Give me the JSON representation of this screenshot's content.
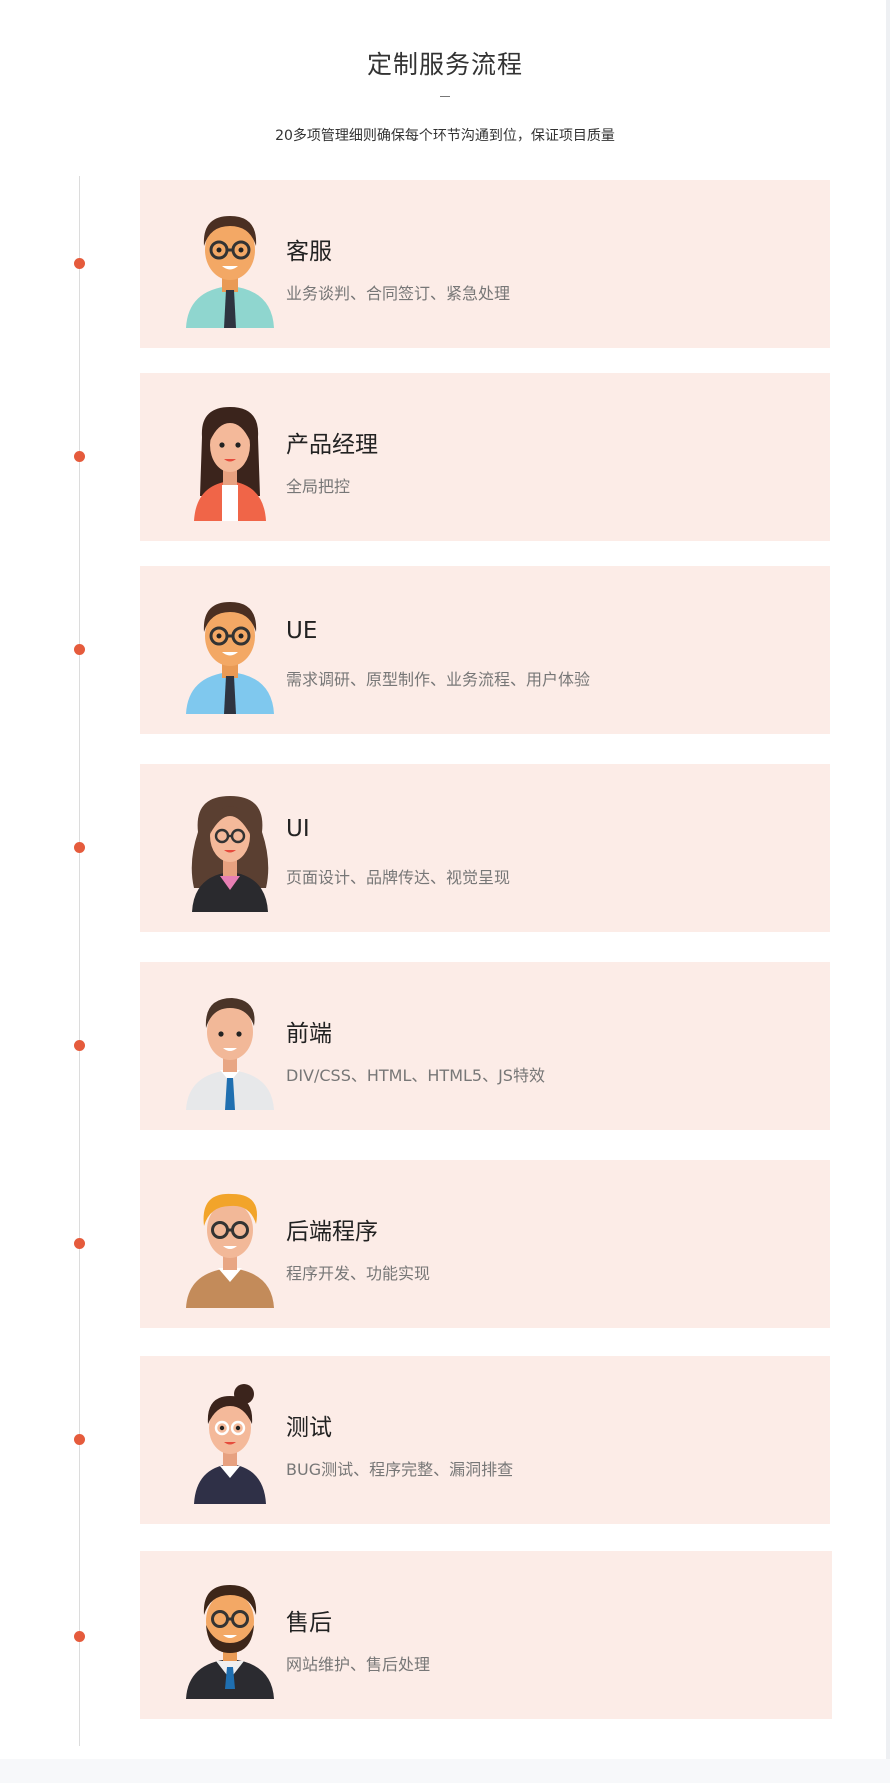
{
  "header": {
    "title": "定制服务流程",
    "subtitle": "20多项管理细则确保每个环节沟通到位，保证项目质量"
  },
  "colors": {
    "accent": "#e55b3c",
    "card_bg": "#fcece7"
  },
  "steps": [
    {
      "title": "客服",
      "desc": "业务谈判、合同签订、紧急处理",
      "avatar": "man-glasses-teal-shirt-icon"
    },
    {
      "title": "产品经理",
      "desc": "全局把控",
      "avatar": "woman-orange-jacket-icon"
    },
    {
      "title": "UE",
      "desc": "需求调研、原型制作、业务流程、用户体验",
      "avatar": "man-glasses-blue-shirt-icon"
    },
    {
      "title": "UI",
      "desc": "页面设计、品牌传达、视觉呈现",
      "avatar": "woman-curly-hair-icon"
    },
    {
      "title": "前端",
      "desc": "DIV/CSS、HTML、HTML5、JS特效",
      "avatar": "man-white-shirt-icon"
    },
    {
      "title": "后端程序",
      "desc": "程序开发、功能实现",
      "avatar": "man-blonde-glasses-icon"
    },
    {
      "title": "测试",
      "desc": "BUG测试、程序完整、漏洞排查",
      "avatar": "woman-bun-glasses-icon"
    },
    {
      "title": "售后",
      "desc": "网站维护、售后处理",
      "avatar": "man-beard-suit-icon"
    }
  ]
}
